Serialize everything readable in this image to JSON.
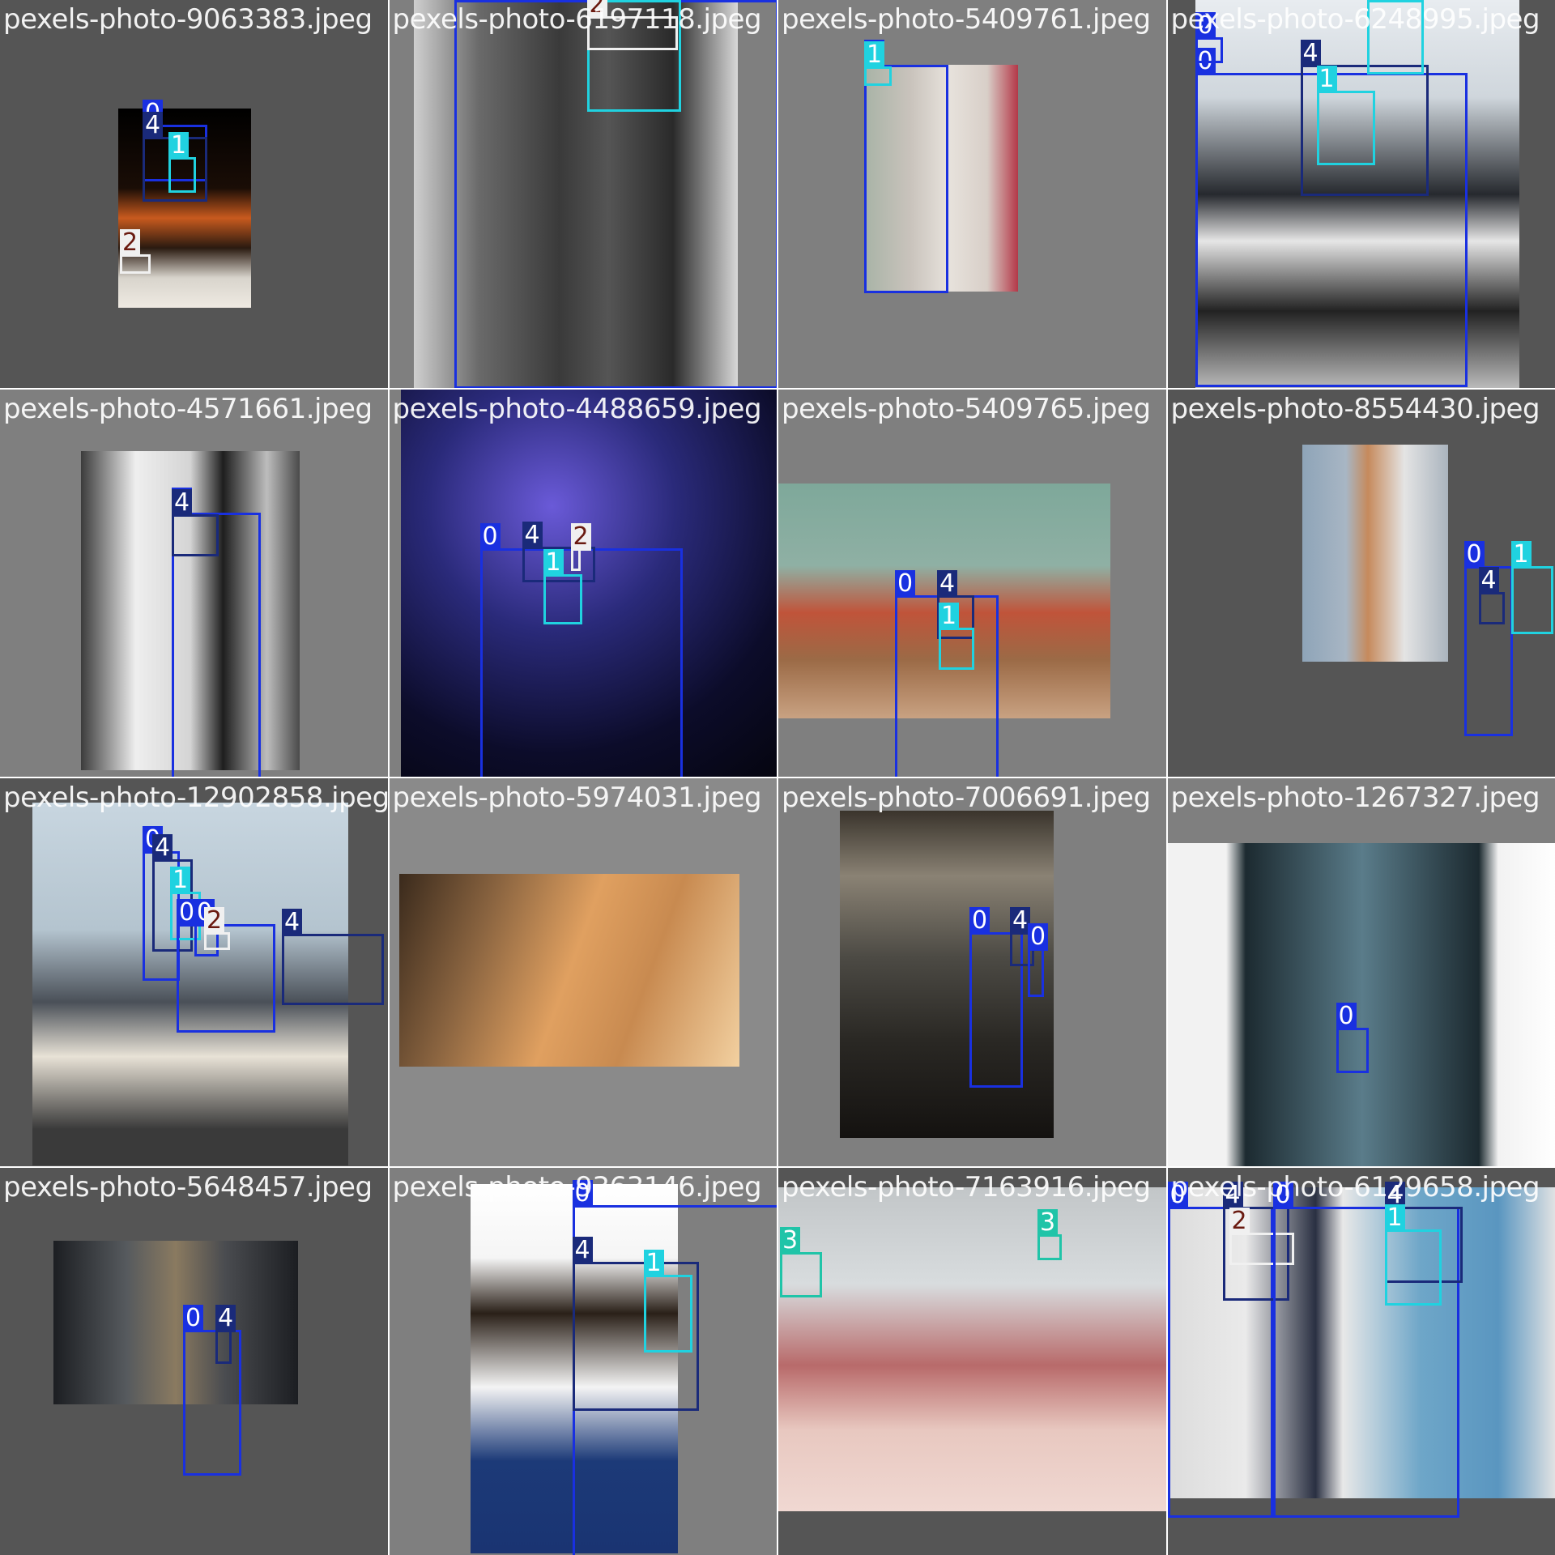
{
  "mosaic": {
    "tiles": [
      {
        "filename": "pexels-photo-9063383.jpeg",
        "bg": "#555555",
        "photo": "linear-gradient(180deg,#000 0%,#1a0d06 40%,#c85a1e 55%,#2a1a10 70%,#d8d4cc 85%,#efeae2 100%)",
        "boxes": [
          {
            "label": "0",
            "color": "#1930e0"
          },
          {
            "label": "4",
            "color": "#1a2a7a"
          },
          {
            "label": "1",
            "color": "#20d2e0"
          },
          {
            "label": "2",
            "color": "#f0f0f0"
          }
        ]
      },
      {
        "filename": "pexels-photo-6197118.jpeg",
        "bg": "#7f7f7f",
        "photo": "linear-gradient(90deg,#cfcfcf 0%,#6a6a6a 20%,#3a3a3a 45%,#555 60%,#2a2a2a 80%,#d8d8d8 100%)",
        "boxes": [
          {
            "label": "0",
            "color": "#1930e0"
          },
          {
            "label": "1",
            "color": "#20d2e0"
          },
          {
            "label": "2",
            "color": "#f0f0f0"
          }
        ]
      },
      {
        "filename": "pexels-photo-5409761.jpeg",
        "bg": "#7f7f7f",
        "photo": "linear-gradient(90deg,#a8b3a6 0%,#c9c3bc 30%,#e7e2dc 55%,#d8cfc8 80%,#b43848 100%)",
        "boxes": [
          {
            "label": "0",
            "color": "#1930e0"
          },
          {
            "label": "1",
            "color": "#20d2e0"
          }
        ]
      },
      {
        "filename": "pexels-photo-6248995.jpeg",
        "bg": "#555555",
        "photo": "linear-gradient(180deg,#e8ecf0 0%,#cfd6dc 25%,#26292e 50%,#e6e6e6 62%,#222 80%,#bbbbbb 100%)",
        "boxes": [
          {
            "label": "0",
            "color": "#1930e0"
          },
          {
            "label": "0",
            "color": "#1930e0"
          },
          {
            "label": "4",
            "color": "#1a2a7a"
          },
          {
            "label": "1",
            "color": "#20d2e0"
          },
          {
            "label": "1",
            "color": "#20d2e0"
          }
        ]
      },
      {
        "filename": "pexels-photo-4571661.jpeg",
        "bg": "#7f7f7f",
        "photo": "linear-gradient(90deg,#3c3c3c 0%,#efefef 25%,#d4d4d4 50%,#1e1e1e 65%,#bdbdbd 85%,#4a4a4a 100%)",
        "boxes": [
          {
            "label": "0",
            "color": "#1930e0"
          },
          {
            "label": "4",
            "color": "#1a2a7a"
          }
        ]
      },
      {
        "filename": "pexels-photo-4488659.jpeg",
        "bg": "#7f7f7f",
        "photo": "radial-gradient(circle at 40% 30%,#6a5ad8 0%,#2a2a7a 35%,#0c0c2a 70%,#05050f 100%)",
        "boxes": [
          {
            "label": "0",
            "color": "#1930e0"
          },
          {
            "label": "4",
            "color": "#1a2a7a"
          },
          {
            "label": "1",
            "color": "#20d2e0"
          },
          {
            "label": "2",
            "color": "#f0f0f0"
          }
        ]
      },
      {
        "filename": "pexels-photo-5409765.jpeg",
        "bg": "#7f7f7f",
        "photo": "linear-gradient(180deg,#7ea89a 0%,#8fb0a4 35%,#c0543a 55%,#9b6a46 75%,#c9a282 100%)",
        "boxes": [
          {
            "label": "0",
            "color": "#1930e0"
          },
          {
            "label": "4",
            "color": "#1a2a7a"
          },
          {
            "label": "1",
            "color": "#20d2e0"
          }
        ]
      },
      {
        "filename": "pexels-photo-8554430.jpeg",
        "bg": "#555555",
        "photo": "linear-gradient(90deg,#8ea4b8 0%,#a8b6c4 30%,#c68a5c 45%,#e4e4e4 70%,#aab4be 100%)",
        "boxes": [
          {
            "label": "0",
            "color": "#1930e0"
          },
          {
            "label": "1",
            "color": "#20d2e0"
          },
          {
            "label": "4",
            "color": "#1a2a7a"
          }
        ]
      },
      {
        "filename": "pexels-photo-12902858.jpeg",
        "bg": "#555555",
        "photo": "linear-gradient(180deg,#c8d6e0 0%,#b4c4cf 35%,#4a5058 55%,#e8e2d6 70%,#3a3a3a 90%)",
        "boxes": [
          {
            "label": "0",
            "color": "#1930e0"
          },
          {
            "label": "4",
            "color": "#1a2a7a"
          },
          {
            "label": "1",
            "color": "#20d2e0"
          },
          {
            "label": "0",
            "color": "#1930e0"
          },
          {
            "label": "0",
            "color": "#1930e0"
          },
          {
            "label": "2",
            "color": "#f0f0f0"
          },
          {
            "label": "4",
            "color": "#1a2a7a"
          }
        ]
      },
      {
        "filename": "pexels-photo-5974031.jpeg",
        "bg": "#8a8a8a",
        "photo": "linear-gradient(110deg,#3a2a1c 0%,#8a6440 25%,#e0a060 50%,#c88a50 70%,#f2d0a0 100%)",
        "boxes": []
      },
      {
        "filename": "pexels-photo-7006691.jpeg",
        "bg": "#7f7f7f",
        "photo": "linear-gradient(180deg,#3a342c 0%,#8a8274 20%,#4c4a44 45%,#2a2824 70%,#141210 100%)",
        "boxes": [
          {
            "label": "0",
            "color": "#1930e0"
          },
          {
            "label": "4",
            "color": "#1a2a7a"
          },
          {
            "label": "0",
            "color": "#1930e0"
          }
        ]
      },
      {
        "filename": "pexels-photo-1267327.jpeg",
        "bg": "#7f7f7f",
        "photo": "linear-gradient(90deg,#f2f2f2 0%,#f2f2f2 15%,#1c2a30 20%,#5a7c8a 50%,#1c2a30 80%,#f2f2f2 85%,#ffffff 100%)",
        "boxes": [
          {
            "label": "0",
            "color": "#1930e0"
          }
        ]
      },
      {
        "filename": "pexels-photo-5648457.jpeg",
        "bg": "#555555",
        "photo": "linear-gradient(90deg,#1c1e22 0%,#565a5e 30%,#8a7a60 50%,#4a4c50 70%,#1c1e22 100%)",
        "boxes": [
          {
            "label": "0",
            "color": "#1930e0"
          },
          {
            "label": "4",
            "color": "#1a2a7a"
          }
        ]
      },
      {
        "filename": "pexels-photo-9363146.jpeg",
        "bg": "#7f7f7f",
        "photo": "linear-gradient(180deg,#ffffff 0%,#f5f5f5 20%,#2a2018 35%,#f4f4f4 55%,#1c3a78 75%,#1a3472 100%)",
        "boxes": [
          {
            "label": "0",
            "color": "#1930e0"
          },
          {
            "label": "4",
            "color": "#1a2a7a"
          },
          {
            "label": "1",
            "color": "#20d2e0"
          }
        ]
      },
      {
        "filename": "pexels-photo-7163916.jpeg",
        "bg": "#555555",
        "photo": "linear-gradient(180deg,#c2c6c8 0%,#d8dcde 30%,#b86a6a 55%,#e8c8c0 75%,#f0d8d2 100%)",
        "boxes": [
          {
            "label": "3",
            "color": "#20c4a8"
          },
          {
            "label": "3",
            "color": "#20c4a8"
          }
        ]
      },
      {
        "filename": "pexels-photo-6129658.jpeg",
        "bg": "#555555",
        "photo": "linear-gradient(90deg,#dcdcdc 0%,#eaeaea 20%,#2a3042 38%,#e8e8e8 45%,#6ea6c8 65%,#5a96c0 85%,#e4e4e4 100%)",
        "boxes": [
          {
            "label": "0",
            "color": "#1930e0"
          },
          {
            "label": "4",
            "color": "#1a2a7a"
          },
          {
            "label": "2",
            "color": "#f0f0f0"
          },
          {
            "label": "0",
            "color": "#1930e0"
          },
          {
            "label": "4",
            "color": "#1a2a7a"
          },
          {
            "label": "1",
            "color": "#20d2e0"
          }
        ]
      }
    ]
  }
}
